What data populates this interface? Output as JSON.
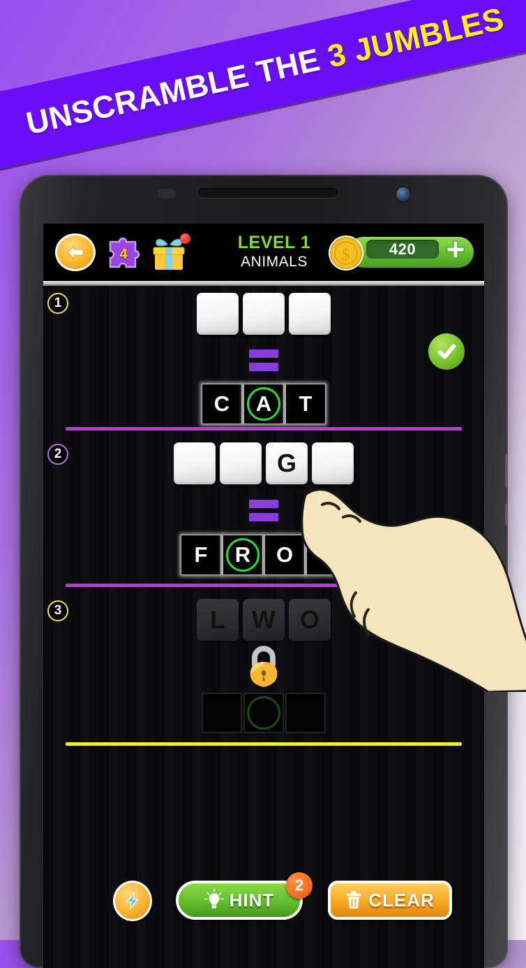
{
  "banner": {
    "text_main": "UNSCRAMBLE THE ",
    "text_highlight": "3 JUMBLES",
    "bg_color": "#6a0ff5",
    "highlight_color": "#ffee22"
  },
  "topbar": {
    "back_label": "back-arrow",
    "puzzle_count": "4",
    "gift_label": "gift",
    "level_title": "LEVEL 1",
    "level_category": "ANIMALS",
    "coin_count": "420",
    "plus_label": "+",
    "level_color": "#7ee031"
  },
  "rows": [
    {
      "number": "1",
      "number_color": "#f5e432",
      "scramble": [
        "",
        "",
        ""
      ],
      "answer": [
        "C",
        "A",
        "T"
      ],
      "ring_index": 1,
      "solved": true,
      "locked": false,
      "divider_color": "#c431e8"
    },
    {
      "number": "2",
      "number_color": "#b96cf0",
      "scramble": [
        "",
        "",
        "G",
        ""
      ],
      "answer": [
        "F",
        "R",
        "O",
        ""
      ],
      "ring_index": 1,
      "solved": false,
      "locked": false,
      "divider_color": "#c431e8"
    },
    {
      "number": "3",
      "number_color": "#f5e432",
      "scramble": [
        "L",
        "W",
        "O"
      ],
      "answer": [
        "",
        "",
        ""
      ],
      "ring_index": 1,
      "solved": false,
      "locked": true,
      "divider_color": "#f5e93a"
    }
  ],
  "bottombar": {
    "bolt_label": "bolt",
    "hint_label": "HINT",
    "hint_badge": "2",
    "clear_label": "CLEAR"
  }
}
